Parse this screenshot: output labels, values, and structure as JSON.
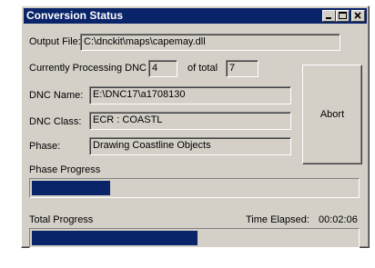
{
  "window": {
    "title": "Conversion Status"
  },
  "output_file": {
    "label": "Output File:",
    "value": "C:\\dnckit\\maps\\capemay.dll"
  },
  "processing": {
    "label": "Currently Processing DNC",
    "current": "4",
    "of_total_label": "of total",
    "total": "7"
  },
  "dnc_name": {
    "label": "DNC Name:",
    "value": "E:\\DNC17\\a1708130"
  },
  "dnc_class": {
    "label": "DNC Class:",
    "value": "ECR : COASTL"
  },
  "phase": {
    "label": "Phase:",
    "value": "Drawing Coastline Objects"
  },
  "abort_button": {
    "label": "Abort"
  },
  "phase_progress": {
    "label": "Phase Progress",
    "fraction": 0.24
  },
  "total_progress": {
    "label": "Total Progress",
    "fraction": 0.51
  },
  "time_elapsed": {
    "label": "Time Elapsed:",
    "value": "00:02:06"
  },
  "colors": {
    "title_bar": "#0a246a",
    "progress_fill": "#0a246a",
    "face": "#d4d0c8"
  },
  "icons": [
    "minimize-icon",
    "maximize-icon",
    "close-icon"
  ]
}
